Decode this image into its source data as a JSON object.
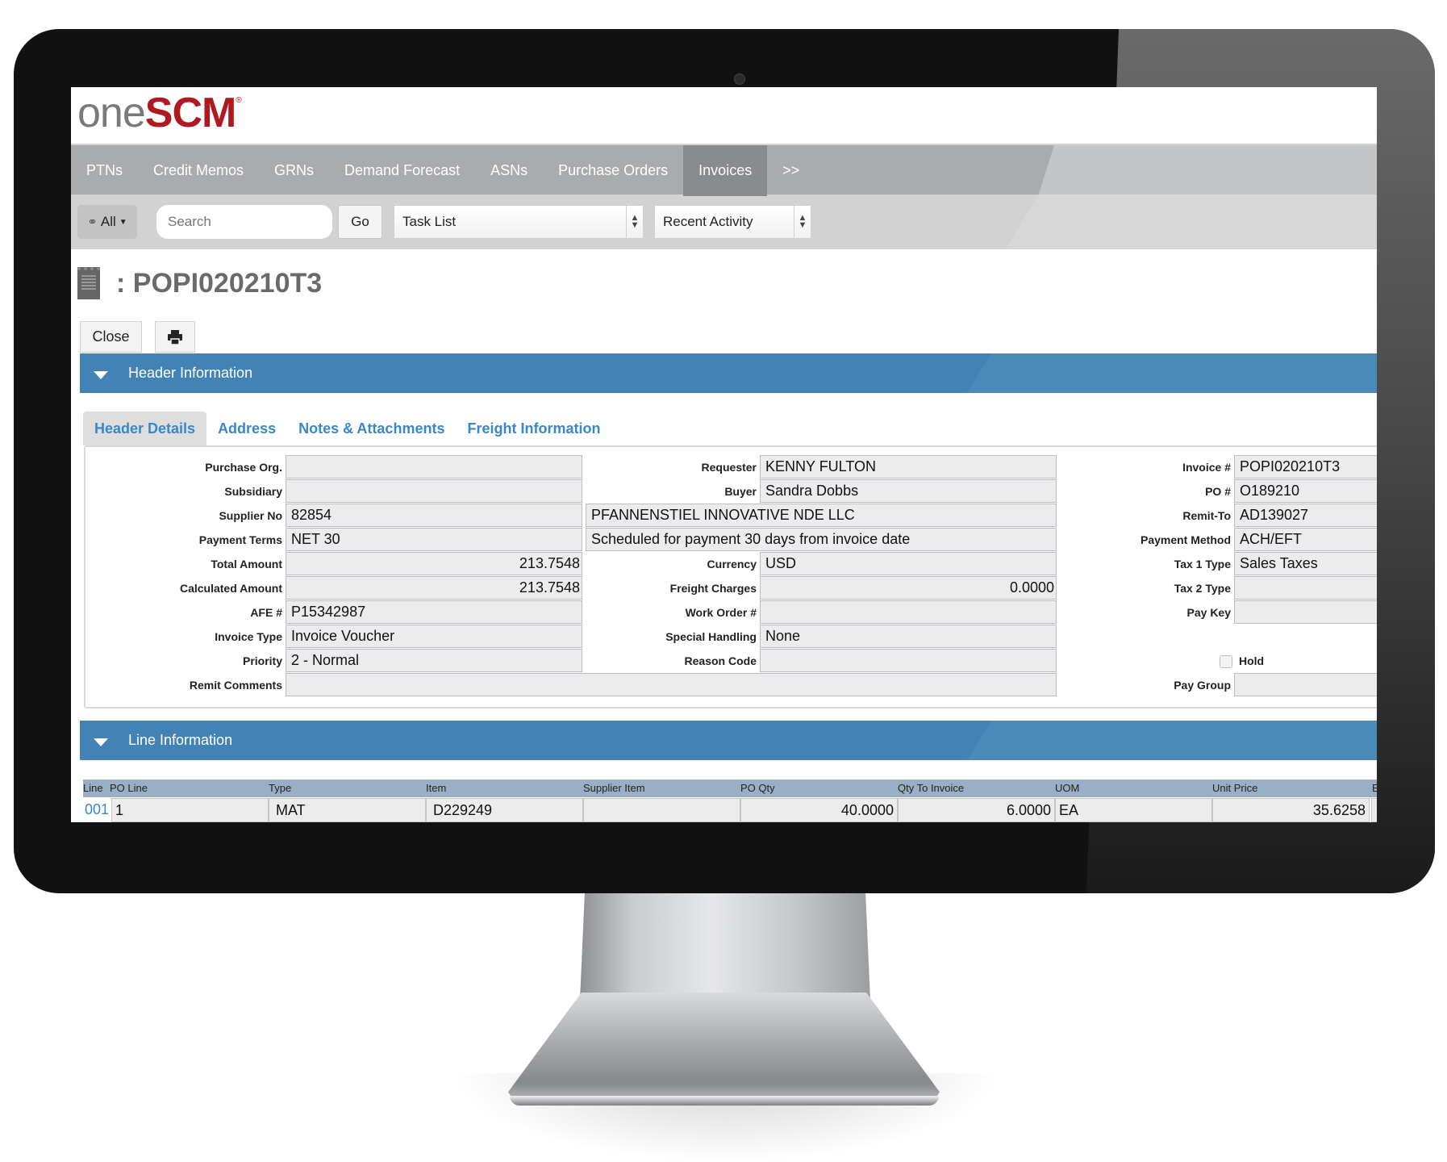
{
  "brand": {
    "logo_light": "one",
    "logo_bold": "SCM",
    "logo_reg": "®"
  },
  "nav": {
    "items": [
      "PTNs",
      "Credit Memos",
      "GRNs",
      "Demand Forecast",
      "ASNs",
      "Purchase Orders",
      "Invoices",
      ">>"
    ],
    "active": "Invoices"
  },
  "toolbar": {
    "scope_label": "All",
    "search_placeholder": "Search",
    "go_label": "Go",
    "task_list_value": "Task List",
    "recent_activity_value": "Recent Activity"
  },
  "page": {
    "title": ": POPI020210T3",
    "close_label": "Close",
    "print_icon": "print-icon"
  },
  "sections": {
    "header_info": "Header Information",
    "line_info": "Line Information"
  },
  "tabs": [
    "Header Details",
    "Address",
    "Notes & Attachments",
    "Freight Information"
  ],
  "form": {
    "left": [
      {
        "label": "Purchase Org.",
        "value": ""
      },
      {
        "label": "Subsidiary",
        "value": ""
      },
      {
        "label": "Supplier No",
        "value": "82854"
      },
      {
        "label": "Payment Terms",
        "value": "NET 30"
      },
      {
        "label": "Total Amount",
        "value": "213.7548"
      },
      {
        "label": "Calculated Amount",
        "value": "213.7548"
      },
      {
        "label": "AFE #",
        "value": "P15342987"
      },
      {
        "label": "Invoice Type",
        "value": "Invoice Voucher"
      },
      {
        "label": "Priority",
        "value": "2 - Normal"
      },
      {
        "label": "Remit Comments",
        "value": ""
      }
    ],
    "middle": [
      {
        "label": "Requester",
        "value": "KENNY FULTON"
      },
      {
        "label": "Buyer",
        "value": "Sandra Dobbs"
      },
      {
        "label": "",
        "value": "PFANNENSTIEL INNOVATIVE NDE LLC"
      },
      {
        "label": "",
        "value": "Scheduled for payment 30 days from invoice date"
      },
      {
        "label": "Currency",
        "value": "USD"
      },
      {
        "label": "Freight Charges",
        "value": "0.0000"
      },
      {
        "label": "Work Order #",
        "value": ""
      },
      {
        "label": "Special Handling",
        "value": "None"
      },
      {
        "label": "Reason Code",
        "value": ""
      }
    ],
    "right": [
      {
        "label": "Invoice #",
        "value": "POPI020210T3"
      },
      {
        "label": "PO #",
        "value": "O189210"
      },
      {
        "label": "Remit-To",
        "value": "AD139027"
      },
      {
        "label": "Payment Method",
        "value": "ACH/EFT"
      },
      {
        "label": "Tax 1 Type",
        "value": "Sales Taxes"
      },
      {
        "label": "Tax 2 Type",
        "value": ""
      },
      {
        "label": "Pay Key",
        "value": ""
      },
      {
        "label": "Hold",
        "value": ""
      },
      {
        "label": "Pay Group",
        "value": ""
      }
    ],
    "hold_checked": false
  },
  "lines": {
    "columns": [
      "Line",
      "PO Line",
      "Type",
      "Item",
      "Supplier Item",
      "PO Qty",
      "Qty To Invoice",
      "UOM",
      "Unit Price",
      "E"
    ],
    "rows": [
      {
        "line": "001",
        "po_line": "1",
        "type": "MAT",
        "item": "D229249",
        "supplier_item": "",
        "po_qty": "40.0000",
        "qty_to_invoice": "6.0000",
        "uom": "EA",
        "unit_price": "35.6258"
      }
    ]
  }
}
